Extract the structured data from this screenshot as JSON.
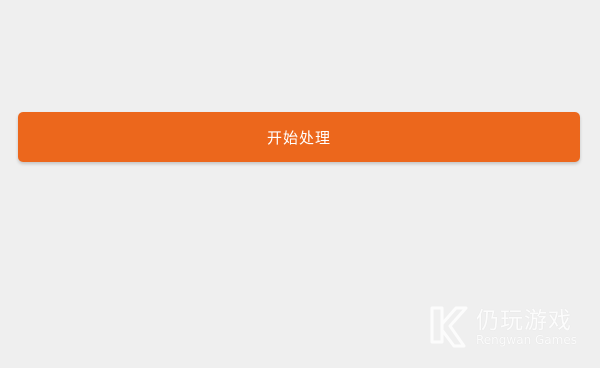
{
  "action": {
    "start_label": "开始处理"
  },
  "watermark": {
    "title": "仍玩游戏",
    "subtitle": "Rengwan Games",
    "logo_icon": "rengwan-logo"
  },
  "colors": {
    "background": "#efefef",
    "button": "#ec671c",
    "button_text": "#ffffff"
  }
}
